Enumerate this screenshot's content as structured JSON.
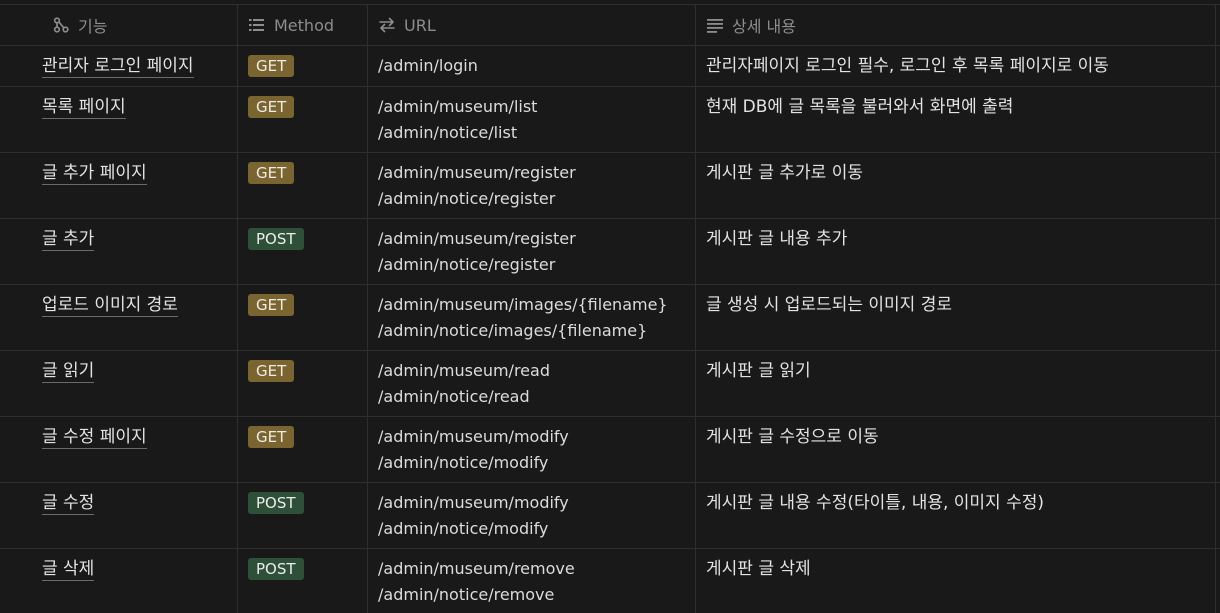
{
  "headers": {
    "feature": "기능",
    "method": "Method",
    "url": "URL",
    "description": "상세 내용"
  },
  "header_icons": {
    "feature": "relation-icon",
    "method": "list-icon",
    "url": "swap-arrows-icon",
    "description": "text-lines-icon"
  },
  "colors": {
    "get_badge": "#7a6530",
    "post_badge": "#2e5038",
    "background": "#191919"
  },
  "rows": [
    {
      "feature": "관리자 로그인 페이지",
      "method": "GET",
      "urls": [
        "/admin/login"
      ],
      "description": "관리자페이지 로그인 필수, 로그인 후 목록 페이지로 이동"
    },
    {
      "feature": "목록 페이지",
      "method": "GET",
      "urls": [
        "/admin/museum/list",
        "/admin/notice/list"
      ],
      "description": "현재 DB에 글 목록을 불러와서 화면에 출력"
    },
    {
      "feature": "글 추가 페이지",
      "method": "GET",
      "urls": [
        "/admin/museum/register",
        "/admin/notice/register"
      ],
      "description": "게시판 글 추가로 이동"
    },
    {
      "feature": "글 추가",
      "method": "POST",
      "urls": [
        "/admin/museum/register",
        "/admin/notice/register"
      ],
      "description": "게시판 글 내용 추가"
    },
    {
      "feature": "업로드 이미지 경로",
      "method": "GET",
      "urls": [
        "/admin/museum/images/{filename}",
        "/admin/notice/images/{filename}"
      ],
      "description": "글 생성 시 업로드되는 이미지 경로"
    },
    {
      "feature": "글 읽기",
      "method": "GET",
      "urls": [
        "/admin/museum/read",
        "/admin/notice/read"
      ],
      "description": "게시판 글 읽기"
    },
    {
      "feature": "글 수정 페이지",
      "method": "GET",
      "urls": [
        "/admin/museum/modify",
        "/admin/notice/modify"
      ],
      "description": "게시판 글 수정으로 이동"
    },
    {
      "feature": "글 수정",
      "method": "POST",
      "urls": [
        "/admin/museum/modify",
        "/admin/notice/modify"
      ],
      "description": "게시판 글 내용 수정(타이틀, 내용, 이미지 수정)"
    },
    {
      "feature": "글 삭제",
      "method": "POST",
      "urls": [
        "/admin/museum/remove",
        "/admin/notice/remove"
      ],
      "description": "게시판 글 삭제"
    }
  ]
}
